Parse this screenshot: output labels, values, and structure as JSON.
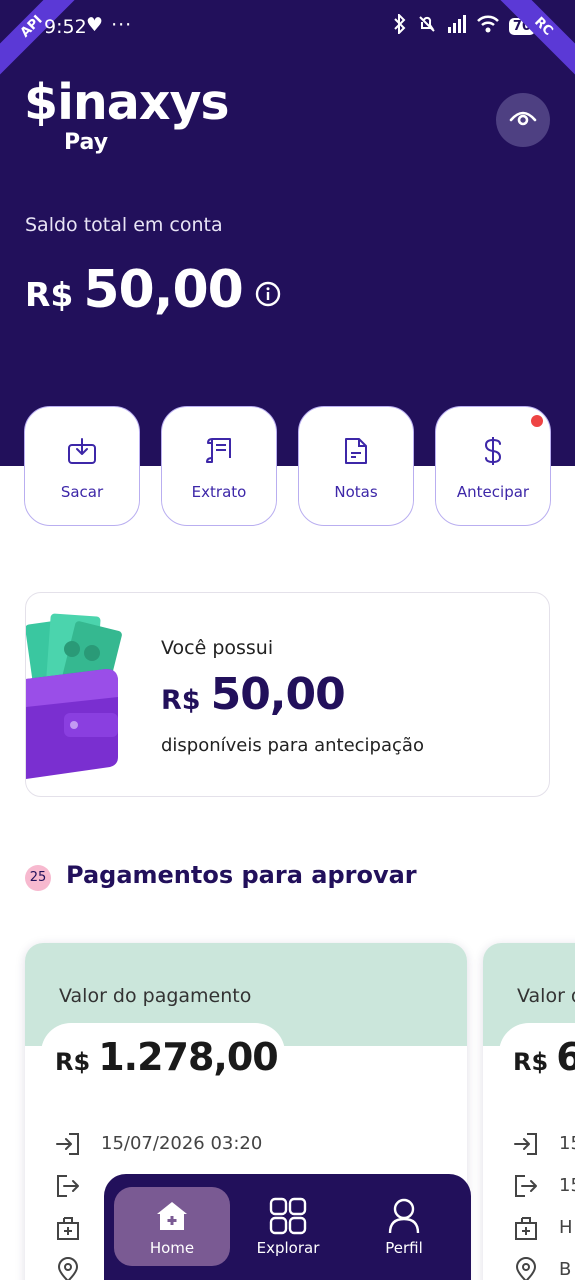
{
  "status_bar": {
    "time": "9:52",
    "extra_icons": "♥ ···",
    "battery": "70",
    "ribbon_left": "API",
    "ribbon_right": "RC"
  },
  "header": {
    "logo_main": "$inaxys",
    "logo_sub": "Pay",
    "balance_label": "Saldo total em conta",
    "balance_currency": "R$",
    "balance_value": "50,00"
  },
  "actions": [
    {
      "label": "Sacar",
      "icon": "download-icon"
    },
    {
      "label": "Extrato",
      "icon": "receipt-icon"
    },
    {
      "label": "Notas",
      "icon": "document-icon"
    },
    {
      "label": "Antecipar",
      "icon": "dollar-icon",
      "has_notification": true
    }
  ],
  "promo": {
    "line1": "Você possui",
    "currency": "R$",
    "value": "50,00",
    "line2": "disponíveis para antecipação"
  },
  "section": {
    "count": "25",
    "title": "Pagamentos para aprovar"
  },
  "payments": [
    {
      "label": "Valor do pagamento",
      "currency": "R$",
      "value": "1.278,00",
      "rows": [
        "15/07/2026 03:20",
        "",
        "",
        ""
      ]
    },
    {
      "label": "Valor d",
      "currency": "R$",
      "value": "6",
      "rows": [
        "15",
        "15",
        "H",
        "B"
      ]
    }
  ],
  "nav": [
    {
      "label": "Home",
      "icon": "home-icon",
      "active": true
    },
    {
      "label": "Explorar",
      "icon": "grid-icon",
      "active": false
    },
    {
      "label": "Perfil",
      "icon": "user-icon",
      "active": false
    }
  ],
  "colors": {
    "brand_dark": "#22105b",
    "accent_purple": "#3d27a8",
    "card_green": "#cbe6db",
    "nav_active": "#7a5a93",
    "badge_pink": "#f7b9cf",
    "notification_red": "#ee4444"
  }
}
